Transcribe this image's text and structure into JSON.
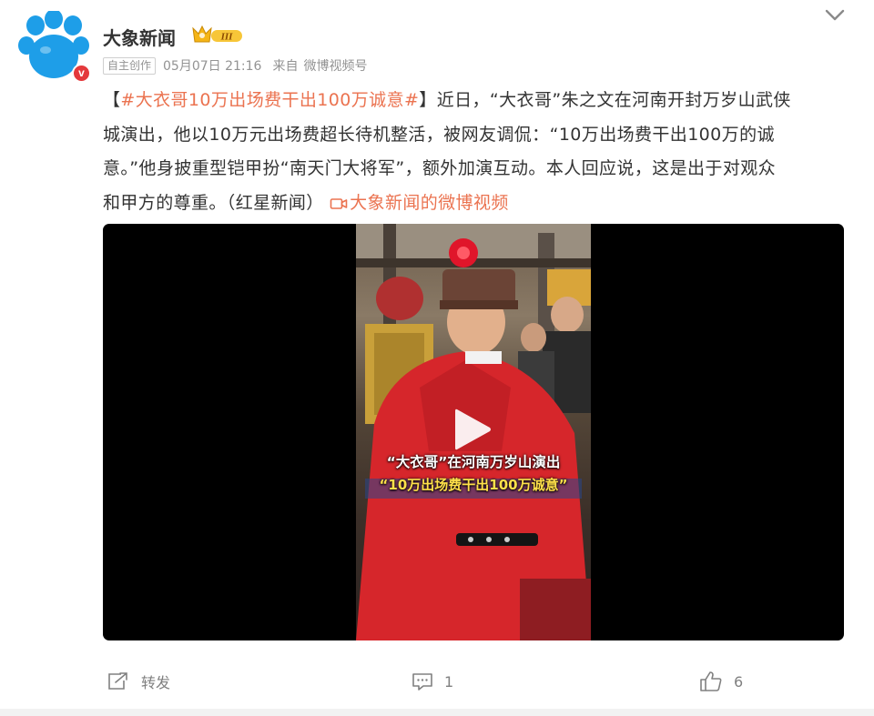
{
  "post": {
    "username": "大象新闻",
    "level_badge": "III",
    "meta": {
      "tag": "自主创作",
      "time": "05月07日 21:16",
      "from_prefix": "来自",
      "source": "微博视频号"
    },
    "text": {
      "open_bracket": "【",
      "topic": "#大衣哥10万出场费干出100万诚意#",
      "line1_rest": "】近日，“大衣哥”朱之文在河南开封万岁山武侠",
      "line2": "城演出，他以10万元出场费超长待机整活，被网友调侃：“10万出场费干出100万的诚",
      "line3": "意。”他身披重型铠甲扮“南天门大将军”，额外加演互动。本人回应说，这是出于对观众",
      "line4": "和甲方的尊重。（红星新闻）",
      "video_link": "大象新闻的微博视频"
    },
    "video": {
      "caption_line1": "“大衣哥”在河南万岁山演出",
      "caption_line2": "“10万出场费干出100万诚意”",
      "play_icon": "play-icon"
    },
    "actions": {
      "repost_label": "转发",
      "comment_count": "1",
      "like_count": "6"
    }
  },
  "icons": {
    "avatar": "paw-logo",
    "verified": "verified-v-icon",
    "crown": "crown-level-icon",
    "chevron": "chevron-down-icon",
    "repost": "repost-icon",
    "comment": "comment-icon",
    "like": "thumbs-up-icon"
  },
  "colors": {
    "topic": "#eb7350",
    "text": "#333333",
    "meta": "#939393",
    "avatar_blue": "#1e9ee8",
    "verified_red": "#e4393c"
  }
}
